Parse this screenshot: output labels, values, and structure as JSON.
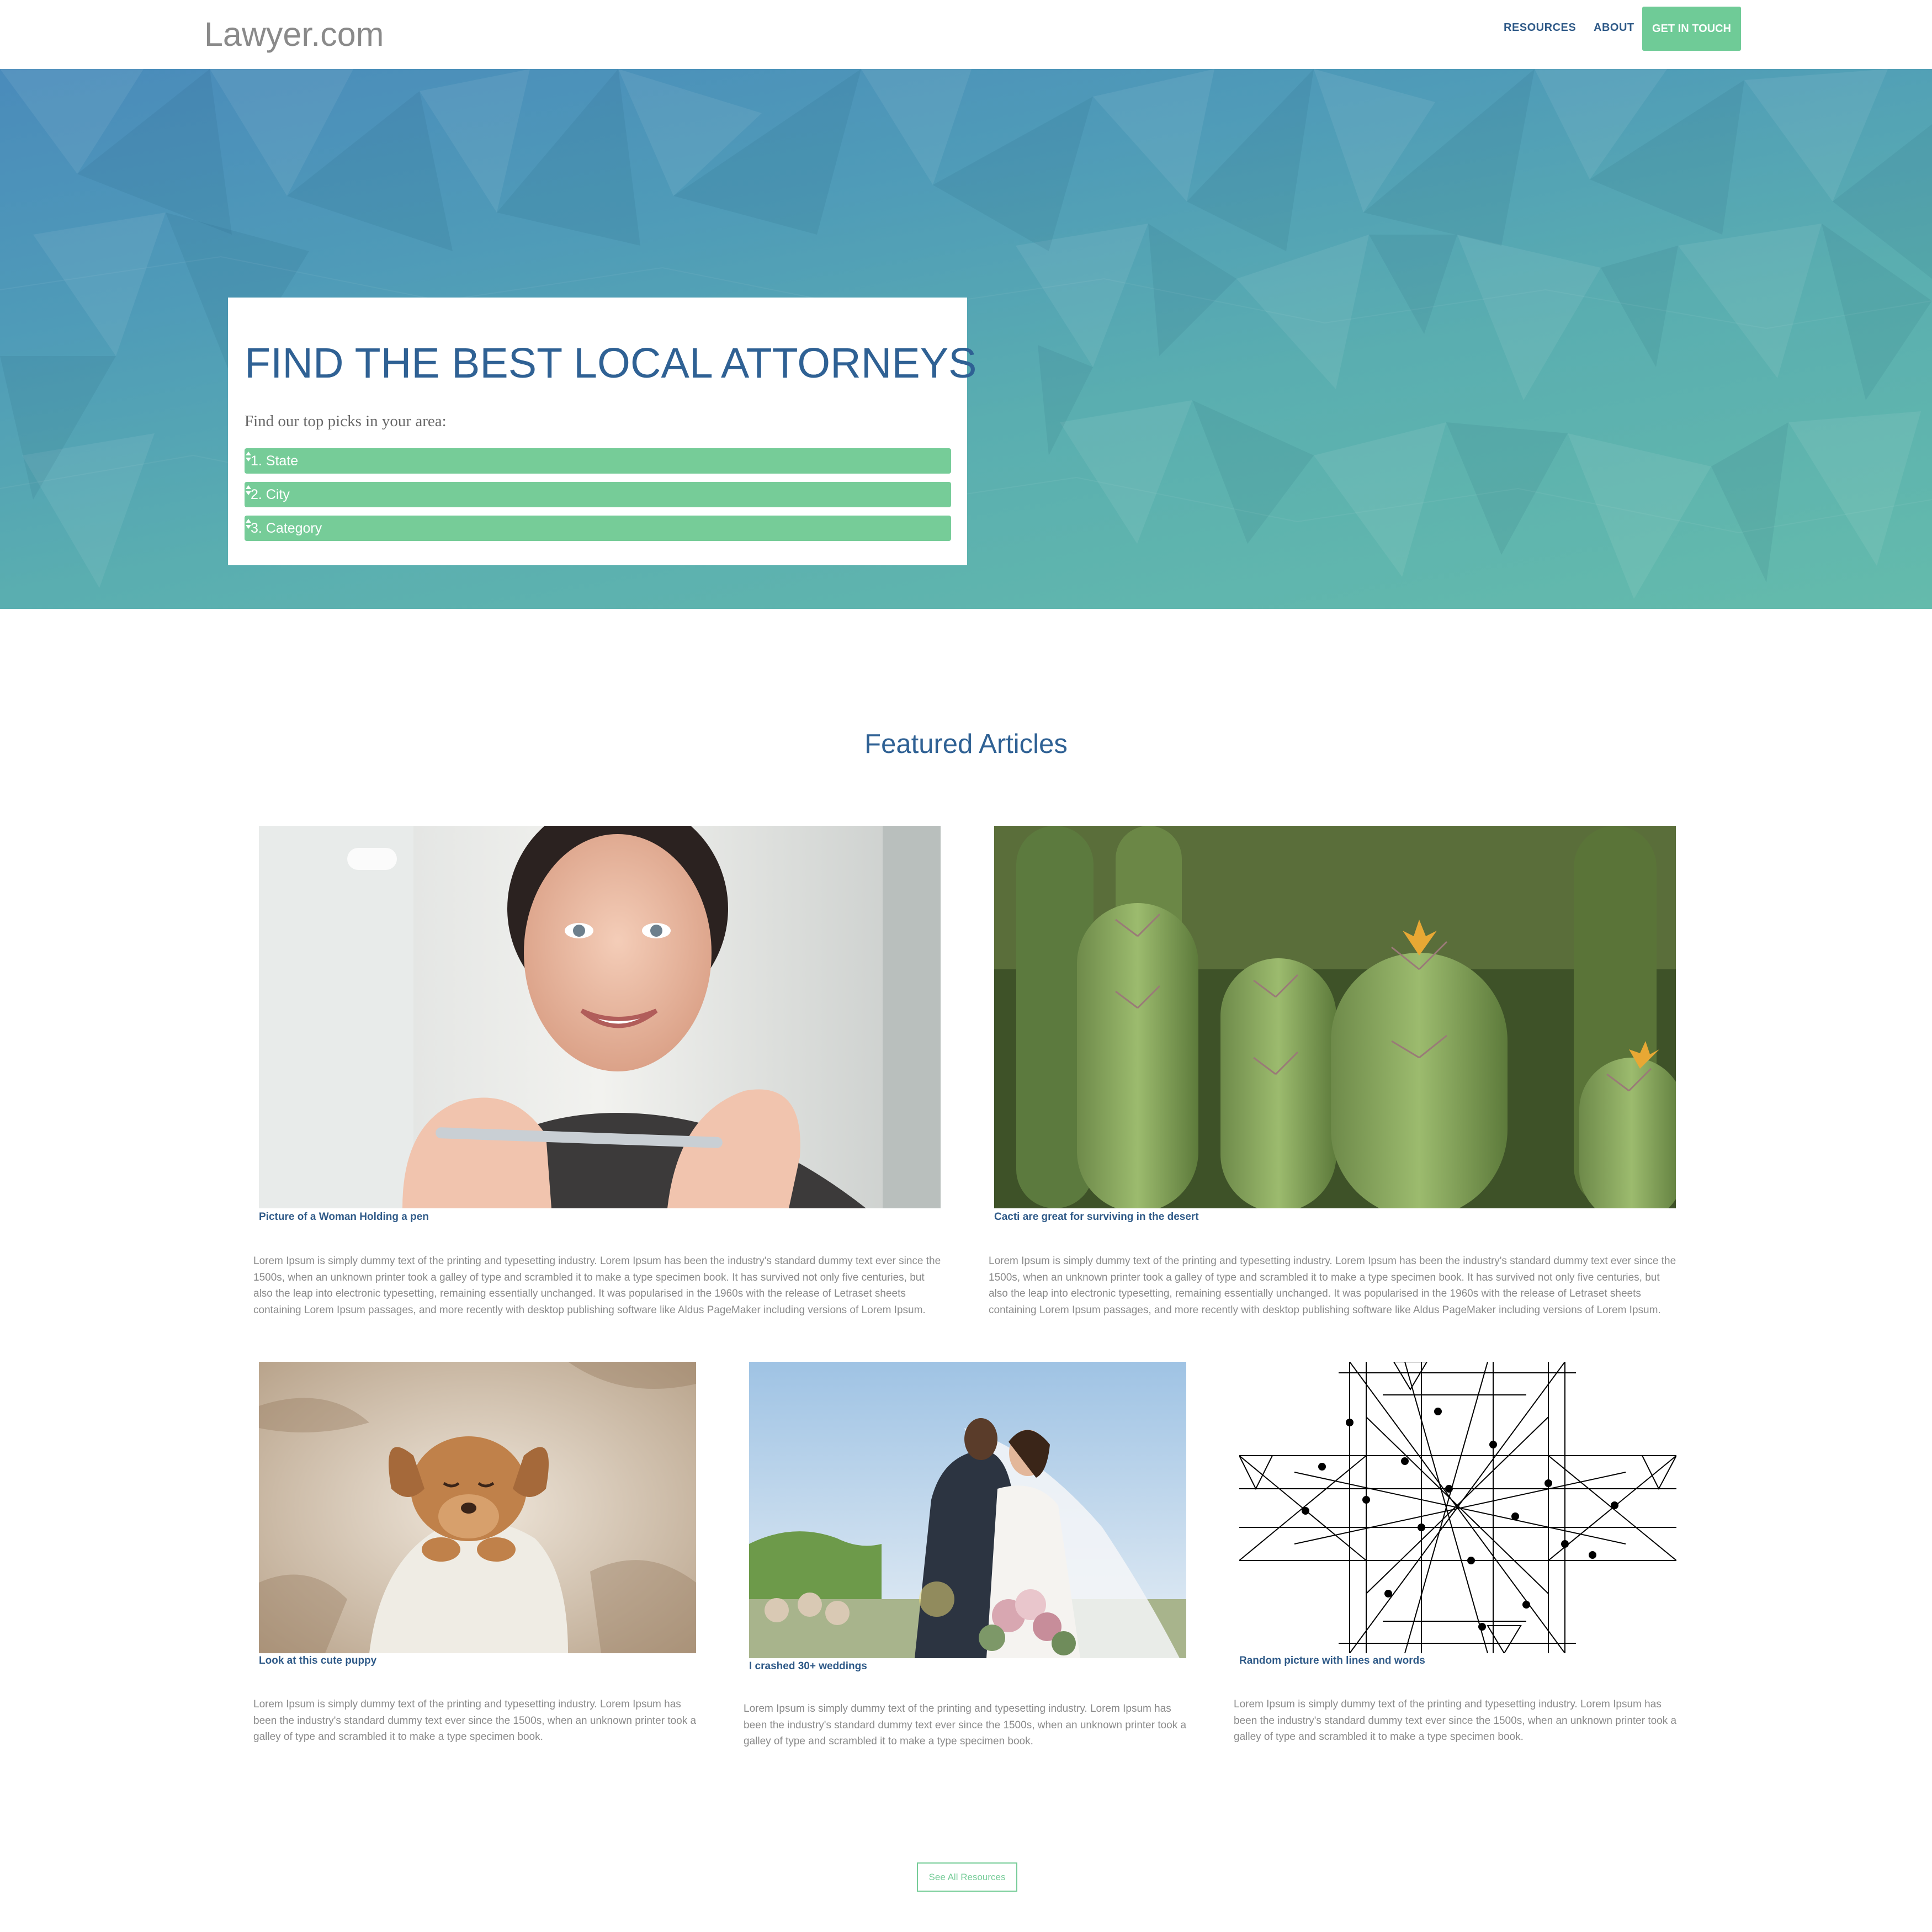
{
  "navbar": {
    "logo": "Lawyer.com",
    "links": [
      "RESOURCES",
      "ABOUT"
    ],
    "cta": "GET IN TOUCH"
  },
  "hero": {
    "title": "FIND THE BEST LOCAL ATTORNEYS",
    "subtitle": "Find our top picks in your area:",
    "selects": [
      "1. State",
      "2. City",
      "3. Category"
    ],
    "accent_color": "#76cc98"
  },
  "featured": {
    "title": "Featured Articles",
    "articles": [
      {
        "caption": "Picture of a Woman Holding a pen",
        "image": "woman-with-pen-photo",
        "body": "Lorem Ipsum is simply dummy text of the printing and typesetting industry. Lorem Ipsum has been the industry's standard dummy text ever since the 1500s, when an unknown printer took a galley of type and scrambled it to make a type specimen book. It has survived not only five centuries, but also the leap into electronic typesetting, remaining essentially unchanged. It was popularised in the 1960s with the release of Letraset sheets containing Lorem Ipsum passages, and more recently with desktop publishing software like Aldus PageMaker including versions of Lorem Ipsum."
      },
      {
        "caption": "Cacti are great for surviving in the desert",
        "image": "cactus-photo",
        "body": "Lorem Ipsum is simply dummy text of the printing and typesetting industry. Lorem Ipsum has been the industry's standard dummy text ever since the 1500s, when an unknown printer took a galley of type and scrambled it to make a type specimen book. It has survived not only five centuries, but also the leap into electronic typesetting, remaining essentially unchanged. It was popularised in the 1960s with the release of Letraset sheets containing Lorem Ipsum passages, and more recently with desktop publishing software like Aldus PageMaker including versions of Lorem Ipsum."
      },
      {
        "caption": "Look at this cute puppy",
        "image": "puppy-photo",
        "body": "Lorem Ipsum is simply dummy text of the printing and typesetting industry. Lorem Ipsum has been the industry's standard dummy text ever since the 1500s, when an unknown printer took a galley of type and scrambled it to make a type specimen book."
      },
      {
        "caption": "I crashed 30+ weddings",
        "image": "wedding-photo",
        "body": "Lorem Ipsum is simply dummy text of the printing and typesetting industry. Lorem Ipsum has been the industry's standard dummy text ever since the 1500s, when an unknown printer took a galley of type and scrambled it to make a type specimen book."
      },
      {
        "caption": "Random picture with lines and words",
        "image": "lines-diagram-picture",
        "body": "Lorem Ipsum is simply dummy text of the printing and typesetting industry. Lorem Ipsum has been the industry's standard dummy text ever since the 1500s, when an unknown printer took a galley of type and scrambled it to make a type specimen book."
      }
    ],
    "see_all": "See All Resources"
  }
}
